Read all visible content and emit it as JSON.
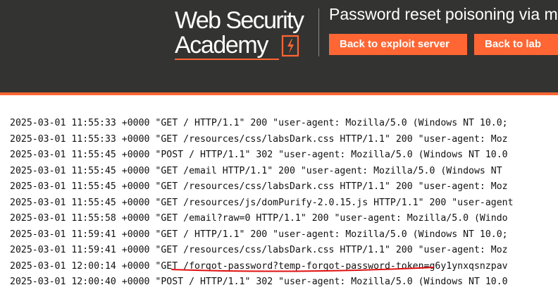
{
  "header": {
    "logo_line1": "Web Security",
    "logo_line2": "Academy",
    "lab_title": "Password reset poisoning via m",
    "buttons": {
      "exploit_server": "Back to exploit server",
      "lab": "Back to lab"
    }
  },
  "colors": {
    "header_bg": "#333332",
    "accent": "#ff6633",
    "annotation": "#e01010"
  },
  "log": {
    "lines": [
      "2025-03-01 11:55:33 +0000 \"GET / HTTP/1.1\" 200 \"user-agent: Mozilla/5.0 (Windows NT 10.0;",
      "2025-03-01 11:55:33 +0000 \"GET /resources/css/labsDark.css HTTP/1.1\" 200 \"user-agent: Moz",
      "2025-03-01 11:55:45 +0000 \"POST / HTTP/1.1\" 302 \"user-agent: Mozilla/5.0 (Windows NT 10.0",
      "2025-03-01 11:55:45 +0000 \"GET /email HTTP/1.1\" 200 \"user-agent: Mozilla/5.0 (Windows NT",
      "2025-03-01 11:55:45 +0000 \"GET /resources/css/labsDark.css HTTP/1.1\" 200 \"user-agent: Moz",
      "2025-03-01 11:55:45 +0000 \"GET /resources/js/domPurify-2.0.15.js HTTP/1.1\" 200 \"user-agent",
      "2025-03-01 11:55:58 +0000 \"GET /email?raw=0 HTTP/1.1\" 200 \"user-agent: Mozilla/5.0 (Windo",
      "2025-03-01 11:59:41 +0000 \"GET / HTTP/1.1\" 200 \"user-agent: Mozilla/5.0 (Windows NT 10.0;",
      "2025-03-01 11:59:41 +0000 \"GET /resources/css/labsDark.css HTTP/1.1\" 200 \"user-agent: Moz",
      "2025-03-01 12:00:14 +0000 \"GET /forgot-password?temp-forgot-password-token=g6y1ynxqsnzpav",
      "2025-03-01 12:00:40 +0000 \"POST / HTTP/1.1\" 302 \"user-agent: Mozilla/5.0 (Windows NT 10.0"
    ]
  }
}
